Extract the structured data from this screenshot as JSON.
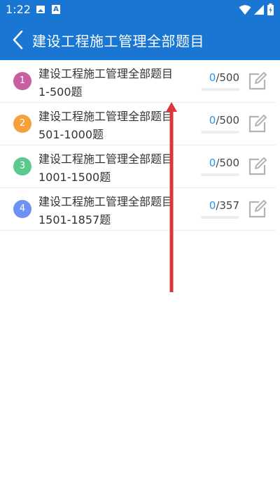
{
  "statusbar": {
    "time": "1:22",
    "icons": [
      "image-icon",
      "a-icon",
      "wifi-icon",
      "signal-icon",
      "battery-icon"
    ]
  },
  "appbar": {
    "title": "建设工程施工管理全部题目",
    "back_icon": "chevron-left-icon"
  },
  "colors": {
    "primary": "#1976d2",
    "accent": "#2196f3",
    "badge_1": "#c95fa0",
    "badge_2": "#f6a03c",
    "badge_3": "#5bc98c",
    "badge_4": "#6d93f2",
    "arrow": "#d9363e"
  },
  "items": [
    {
      "num": "1",
      "title": "建设工程施工管理全部题目",
      "range": "1-500题",
      "done": "0",
      "total": "/500",
      "progress": 0,
      "edit_icon": "edit-icon"
    },
    {
      "num": "2",
      "title": "建设工程施工管理全部题目",
      "range": "501-1000题",
      "done": "0",
      "total": "/500",
      "progress": 0,
      "edit_icon": "edit-icon"
    },
    {
      "num": "3",
      "title": "建设工程施工管理全部题目",
      "range": "1001-1500题",
      "done": "0",
      "total": "/500",
      "progress": 0,
      "edit_icon": "edit-icon"
    },
    {
      "num": "4",
      "title": "建设工程施工管理全部题目",
      "range": "1501-1857题",
      "done": "0",
      "total": "/357",
      "progress": 0,
      "edit_icon": "edit-icon"
    }
  ]
}
